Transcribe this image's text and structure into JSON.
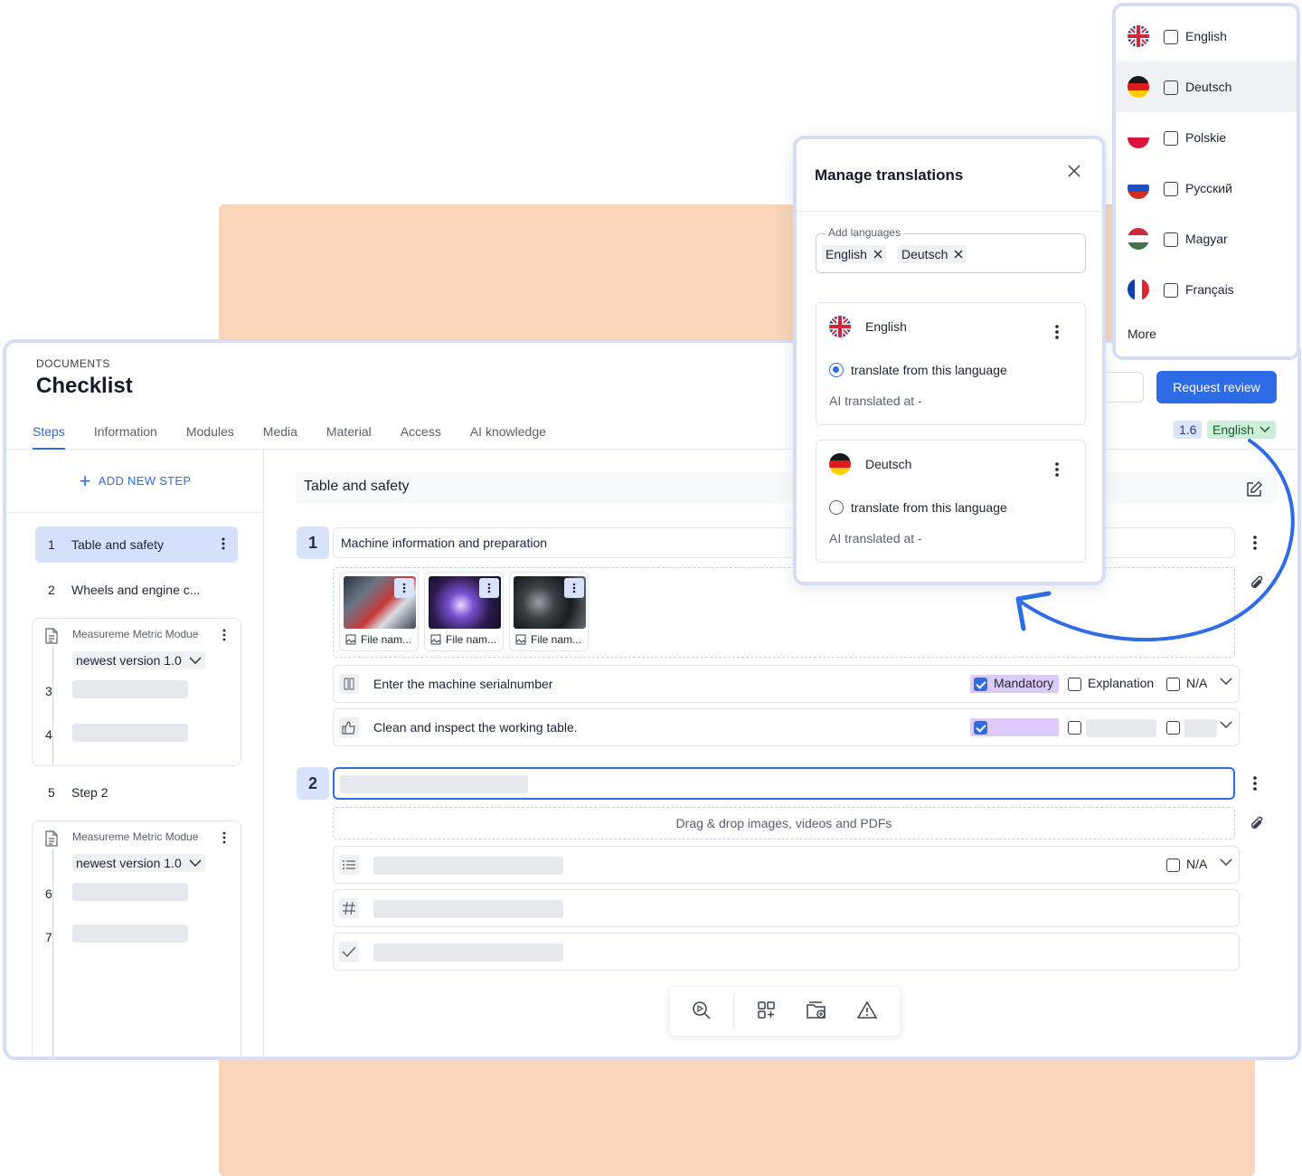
{
  "header": {
    "breadcrumb": "DOCUMENTS",
    "title": "Checklist",
    "request_review": "Request review",
    "version": "1.6",
    "language": "English"
  },
  "tabs": [
    "Steps",
    "Information",
    "Modules",
    "Media",
    "Material",
    "Access",
    "AI knowledge"
  ],
  "sidebar": {
    "add_step": "ADD NEW STEP",
    "steps": [
      {
        "num": "1",
        "label": "Table and safety"
      },
      {
        "num": "2",
        "label": "Wheels and engine c..."
      },
      {
        "num": "5",
        "label": "Step 2"
      }
    ],
    "modules": [
      {
        "title": "Measureme Metric Modue",
        "version": "newest version 1.0",
        "subs": [
          "3",
          "4"
        ]
      },
      {
        "title": "Measureme Metric Modue",
        "version": "newest version 1.0",
        "subs": [
          "6",
          "7"
        ]
      }
    ]
  },
  "content": {
    "section_title": "Table and safety",
    "step1": {
      "badge": "1",
      "field": "Machine information and preparation",
      "files": [
        "File nam...",
        "File nam...",
        "File nam..."
      ],
      "rows": [
        {
          "text": "Enter the machine serialnumber",
          "mandatory": "Mandatory",
          "explanation": "Explanation",
          "na": "N/A"
        },
        {
          "text": "Clean and inspect the working table."
        }
      ]
    },
    "step2": {
      "badge": "2",
      "dropzone": "Drag & drop images, videos and PDFs",
      "na": "N/A"
    }
  },
  "modal": {
    "title": "Manage translations",
    "add_languages_label": "Add languages",
    "chips": [
      "English",
      "Deutsch"
    ],
    "cards": [
      {
        "name": "English",
        "radio": "translate from this language",
        "ai": "AI translated at  -",
        "selected": true
      },
      {
        "name": "Deutsch",
        "radio": "translate from this language",
        "ai": "AI translated at  -",
        "selected": false
      }
    ]
  },
  "dropdown": {
    "languages": [
      "English",
      "Deutsch",
      "Polskie",
      "Русский",
      "Magyar",
      "Français"
    ],
    "more": "More"
  },
  "colors": {
    "accent": "#2e6be6",
    "peach": "#f8d4b8",
    "mandatory_highlight": "#dccbf8",
    "language_pill": "#cdeed9"
  }
}
